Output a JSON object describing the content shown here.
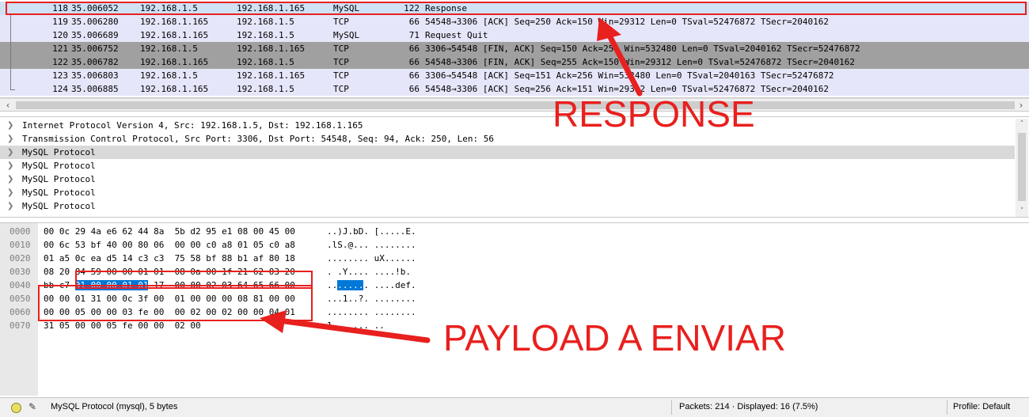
{
  "packets": [
    {
      "no": "118",
      "time": "35.006052",
      "src": "192.168.1.5",
      "dst": "192.168.1.165",
      "proto": "MySQL",
      "len": "122",
      "info": "Response"
    },
    {
      "no": "119",
      "time": "35.006280",
      "src": "192.168.1.165",
      "dst": "192.168.1.5",
      "proto": "TCP",
      "len": "66",
      "info": "54548→3306 [ACK] Seq=250 Ack=150 Win=29312 Len=0 TSval=52476872 TSecr=2040162"
    },
    {
      "no": "120",
      "time": "35.006689",
      "src": "192.168.1.165",
      "dst": "192.168.1.5",
      "proto": "MySQL",
      "len": "71",
      "info": "Request Quit"
    },
    {
      "no": "121",
      "time": "35.006752",
      "src": "192.168.1.5",
      "dst": "192.168.1.165",
      "proto": "TCP",
      "len": "66",
      "info": "3306→54548 [FIN, ACK] Seq=150 Ack=255 Win=532480 Len=0 TSval=2040162 TSecr=52476872"
    },
    {
      "no": "122",
      "time": "35.006782",
      "src": "192.168.1.165",
      "dst": "192.168.1.5",
      "proto": "TCP",
      "len": "66",
      "info": "54548→3306 [FIN, ACK] Seq=255 Ack=150 Win=29312 Len=0 TSval=52476872 TSecr=2040162"
    },
    {
      "no": "123",
      "time": "35.006803",
      "src": "192.168.1.5",
      "dst": "192.168.1.165",
      "proto": "TCP",
      "len": "66",
      "info": "3306→54548 [ACK] Seq=151 Ack=256 Win=532480 Len=0 TSval=2040163 TSecr=52476872"
    },
    {
      "no": "124",
      "time": "35.006885",
      "src": "192.168.1.165",
      "dst": "192.168.1.5",
      "proto": "TCP",
      "len": "66",
      "info": "54548→3306 [ACK] Seq=256 Ack=151 Win=29312 Len=0 TSval=52476872 TSecr=2040162"
    }
  ],
  "details": [
    "Internet Protocol Version 4, Src: 192.168.1.5, Dst: 192.168.1.165",
    "Transmission Control Protocol, Src Port: 3306, Dst Port: 54548, Seq: 94, Ack: 250, Len: 56",
    "MySQL Protocol",
    "MySQL Protocol",
    "MySQL Protocol",
    "MySQL Protocol",
    "MySQL Protocol"
  ],
  "bytes": [
    {
      "off": "0000",
      "hex_pre": "00 0c 29 4a e6 62 44 8a  5b d2 95 e1 08 00 45 00",
      "hex_sel": "",
      "hex_post": "",
      "asc_pre": "..)J.bD. [.....E.",
      "asc_sel": "",
      "asc_post": ""
    },
    {
      "off": "0010",
      "hex_pre": "00 6c 53 bf 40 00 80 06  00 00 c0 a8 01 05 c0 a8",
      "hex_sel": "",
      "hex_post": "",
      "asc_pre": ".lS.@... ........",
      "asc_sel": "",
      "asc_post": ""
    },
    {
      "off": "0020",
      "hex_pre": "01 a5 0c ea d5 14 c3 c3  75 58 bf 88 b1 af 80 18",
      "hex_sel": "",
      "hex_post": "",
      "asc_pre": "........ uX......",
      "asc_sel": "",
      "asc_post": ""
    },
    {
      "off": "0030",
      "hex_pre": "08 20 84 59 00 00 01 01  08 0a 00 1f 21 62 03 20",
      "hex_sel": "",
      "hex_post": "",
      "asc_pre": ". .Y.... ....!b. ",
      "asc_sel": "",
      "asc_post": ""
    },
    {
      "off": "0040",
      "hex_pre": "bb c7 ",
      "hex_sel": "01 00 00 01 01",
      "hex_post": " 17  00 00 02 03 64 65 66 00",
      "asc_pre": "..",
      "asc_sel": ".....",
      "asc_post": ". ....def."
    },
    {
      "off": "0050",
      "hex_pre": "00 00 01 31 00 0c 3f 00  01 00 00 00 08 81 00 00",
      "hex_sel": "",
      "hex_post": "",
      "asc_pre": "...1..?. ........",
      "asc_sel": "",
      "asc_post": ""
    },
    {
      "off": "0060",
      "hex_pre": "00 00 05 00 00 03 fe 00  00 02 00 02 00 00 04 01",
      "hex_sel": "",
      "hex_post": "",
      "asc_pre": "........ ........",
      "asc_sel": "",
      "asc_post": ""
    },
    {
      "off": "0070",
      "hex_pre": "31 05 00 00 05 fe 00 00  02 00",
      "hex_sel": "",
      "hex_post": "",
      "asc_pre": "1....... ..",
      "asc_sel": "",
      "asc_post": ""
    }
  ],
  "status": {
    "field_info": "MySQL Protocol (mysql), 5 bytes",
    "packets": "Packets: 214 · Displayed: 16 (7.5%)",
    "profile": "Profile: Default"
  },
  "annotations": {
    "response_label": "RESPONSE",
    "payload_label": "PAYLOAD A ENVIAR",
    "color": "#e8201e"
  },
  "icons": {
    "tree_collapsed": "chevron-right-icon",
    "scroll_left": "chevron-left-icon",
    "scroll_right": "chevron-right-icon",
    "scroll_up": "chevron-up-icon",
    "scroll_down": "chevron-down-icon",
    "status_led": "capture-status-icon",
    "edit": "edit-comment-icon"
  }
}
